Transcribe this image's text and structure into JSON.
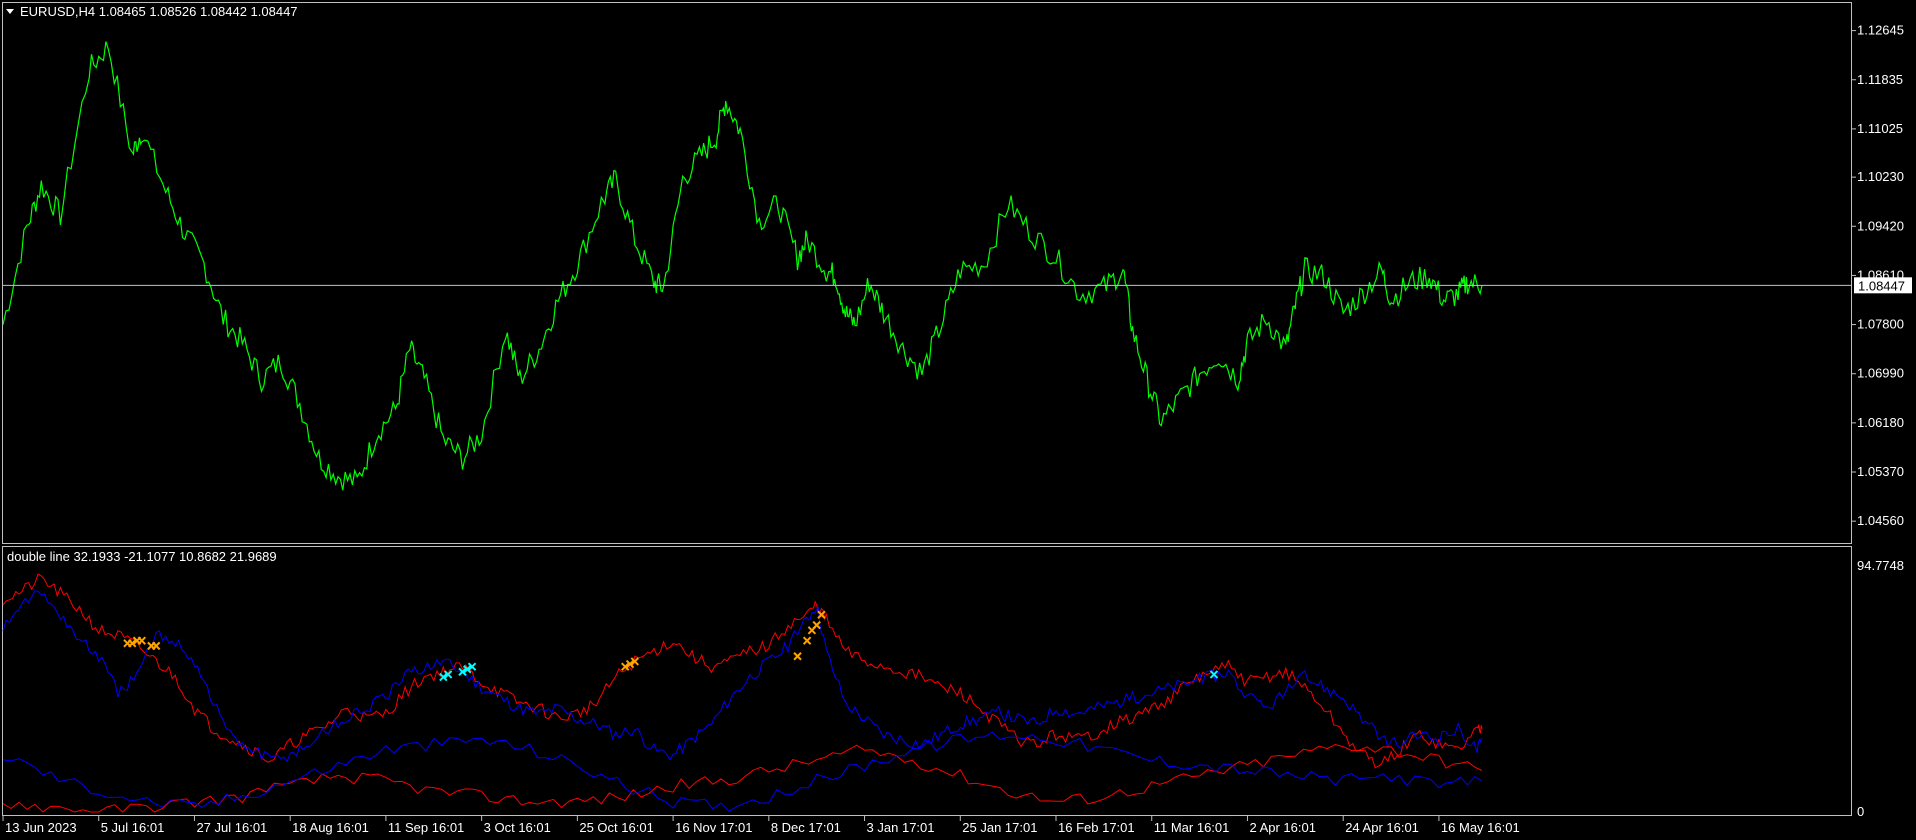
{
  "window": {
    "symbol_header": "EURUSD,H4  1.08465 1.08526 1.08442 1.08447",
    "indicator_header": "double line 32.1933 -21.1077 10.8682 21.9689"
  },
  "colors": {
    "background": "#000000",
    "price": "#00ff00",
    "last_price_line": "#b4c8dc",
    "line_red": "#ff0000",
    "line_blue": "#0000ff",
    "marker_orange": "#ffa500",
    "marker_cyan": "#00ffff",
    "panel_border": "#c0c0c0"
  },
  "icons": {
    "dropdown": "triangle-down-icon"
  },
  "chart_data": [
    {
      "type": "line",
      "panel": "main",
      "title": "EURUSD,H4",
      "ohlc_header": {
        "open": 1.08465,
        "high": 1.08526,
        "low": 1.08442,
        "close": 1.08447
      },
      "last_price": 1.08447,
      "last_price_label": "1.08447",
      "ylim": [
        1.042,
        1.131
      ],
      "y_ticks": [
        "1.12645",
        "1.11835",
        "1.11025",
        "1.10230",
        "1.09420",
        "1.08610",
        "1.07800",
        "1.06990",
        "1.06180",
        "1.05370",
        "1.04560"
      ],
      "y_tick_values": [
        1.12645,
        1.11835,
        1.11025,
        1.1023,
        1.0942,
        1.0861,
        1.078,
        1.0699,
        1.0618,
        1.0537,
        1.0456
      ],
      "x_ticks": [
        "13 Jun 2023",
        "5 Jul 16:01",
        "27 Jul 16:01",
        "18 Aug 16:01",
        "11 Sep 16:01",
        "3 Oct 16:01",
        "25 Oct 16:01",
        "16 Nov 17:01",
        "8 Dec 17:01",
        "3 Jan 17:01",
        "25 Jan 17:01",
        "16 Feb 17:01",
        "11 Mar 16:01",
        "2 Apr 16:01",
        "24 Apr 16:01",
        "16 May 16:01"
      ],
      "x_tick_bar_index": [
        0,
        20,
        40,
        60,
        80,
        100,
        120,
        140,
        160,
        180,
        200,
        220,
        240,
        260,
        280,
        300
      ],
      "bar_count": 310,
      "series": [
        {
          "color": "#00ff00",
          "x": [
            0,
            5,
            8,
            12,
            18,
            22,
            27,
            29,
            34,
            38,
            42,
            46,
            50,
            54,
            58,
            62,
            66,
            70,
            74,
            78,
            82,
            85,
            88,
            92,
            96,
            100,
            105,
            108,
            112,
            116,
            120,
            125,
            128,
            132,
            136,
            138,
            142,
            146,
            149,
            151,
            154,
            158,
            162,
            166,
            168,
            172,
            174,
            176,
            178,
            181,
            184,
            188,
            192,
            196,
            200,
            205,
            210,
            215,
            220,
            225,
            230,
            234,
            236,
            239,
            242,
            246,
            250,
            254,
            258,
            260,
            264,
            268,
            270,
            272,
            276,
            280,
            284,
            288,
            290,
            294,
            298,
            301,
            304,
            306,
            309
          ],
          "y": [
            1.078,
            1.094,
            1.101,
            1.096,
            1.12,
            1.124,
            1.106,
            1.11,
            1.1,
            1.093,
            1.088,
            1.079,
            1.075,
            1.069,
            1.072,
            1.065,
            1.056,
            1.053,
            1.052,
            1.06,
            1.064,
            1.074,
            1.069,
            1.059,
            1.056,
            1.06,
            1.077,
            1.069,
            1.074,
            1.082,
            1.088,
            1.098,
            1.102,
            1.092,
            1.085,
            1.084,
            1.102,
            1.106,
            1.109,
            1.115,
            1.11,
            1.095,
            1.098,
            1.089,
            1.092,
            1.087,
            1.086,
            1.08,
            1.078,
            1.085,
            1.08,
            1.074,
            1.07,
            1.078,
            1.087,
            1.088,
            1.098,
            1.093,
            1.089,
            1.083,
            1.084,
            1.087,
            1.077,
            1.069,
            1.062,
            1.066,
            1.07,
            1.073,
            1.069,
            1.075,
            1.079,
            1.074,
            1.081,
            1.087,
            1.086,
            1.08,
            1.083,
            1.087,
            1.082,
            1.085,
            1.086,
            1.082,
            1.083,
            1.085,
            1.0845
          ]
        }
      ]
    },
    {
      "type": "line",
      "panel": "indicator",
      "title": "double line",
      "header_values": [
        32.1933,
        -21.1077,
        10.8682,
        21.9689
      ],
      "ylim": [
        0,
        94.7748
      ],
      "y_ticks": [
        "94.7748",
        "0"
      ],
      "y_tick_values": [
        94.7748,
        0
      ],
      "series": [
        {
          "color": "#ff0000",
          "x": [
            0,
            4,
            8,
            12,
            16,
            20,
            24,
            28,
            32,
            36,
            40,
            44,
            48,
            52,
            56,
            60,
            64,
            68,
            72,
            76,
            80,
            84,
            88,
            92,
            96,
            100,
            104,
            108,
            112,
            116,
            120,
            124,
            128,
            132,
            136,
            140,
            144,
            148,
            152,
            156,
            160,
            164,
            168,
            170,
            172,
            176,
            180,
            184,
            188,
            192,
            196,
            200,
            204,
            208,
            212,
            216,
            220,
            224,
            228,
            232,
            236,
            240,
            244,
            248,
            252,
            256,
            260,
            264,
            268,
            272,
            276,
            280,
            284,
            288,
            292,
            296,
            300,
            304,
            308,
            309
          ],
          "y": [
            82,
            85,
            90,
            84,
            78,
            70,
            68,
            64,
            58,
            52,
            40,
            32,
            28,
            24,
            20,
            26,
            30,
            34,
            40,
            36,
            38,
            46,
            52,
            54,
            56,
            50,
            46,
            42,
            40,
            36,
            38,
            42,
            52,
            58,
            62,
            66,
            60,
            56,
            58,
            62,
            64,
            72,
            76,
            80,
            74,
            62,
            58,
            56,
            54,
            52,
            48,
            46,
            40,
            34,
            28,
            26,
            30,
            28,
            30,
            34,
            36,
            40,
            44,
            50,
            54,
            56,
            50,
            52,
            54,
            48,
            40,
            30,
            22,
            18,
            24,
            30,
            26,
            24,
            32,
            32
          ]
        },
        {
          "color": "#0000ff",
          "x": [
            0,
            4,
            8,
            12,
            16,
            20,
            24,
            28,
            32,
            36,
            40,
            44,
            48,
            52,
            56,
            60,
            64,
            68,
            72,
            76,
            80,
            84,
            88,
            92,
            96,
            100,
            104,
            108,
            112,
            116,
            120,
            124,
            128,
            132,
            136,
            140,
            144,
            148,
            152,
            156,
            160,
            164,
            168,
            170,
            172,
            176,
            180,
            184,
            188,
            192,
            196,
            200,
            204,
            208,
            212,
            216,
            220,
            224,
            228,
            232,
            236,
            240,
            244,
            248,
            252,
            256,
            260,
            264,
            268,
            272,
            276,
            280,
            284,
            288,
            292,
            296,
            300,
            304,
            308,
            309
          ],
          "y": [
            72,
            82,
            84,
            76,
            66,
            60,
            46,
            52,
            68,
            66,
            58,
            42,
            28,
            24,
            20,
            22,
            26,
            32,
            36,
            40,
            44,
            52,
            56,
            58,
            54,
            48,
            44,
            40,
            38,
            40,
            36,
            34,
            30,
            32,
            24,
            22,
            28,
            34,
            44,
            52,
            58,
            64,
            74,
            80,
            62,
            42,
            36,
            30,
            28,
            26,
            30,
            34,
            36,
            38,
            36,
            34,
            40,
            38,
            40,
            42,
            44,
            46,
            48,
            50,
            52,
            54,
            44,
            40,
            46,
            52,
            48,
            44,
            36,
            28,
            26,
            30,
            28,
            32,
            24,
            28
          ]
        },
        {
          "color": "#ff0000",
          "x": [
            0,
            10,
            20,
            30,
            40,
            50,
            60,
            70,
            80,
            90,
            100,
            110,
            120,
            130,
            140,
            150,
            160,
            170,
            180,
            190,
            200,
            210,
            220,
            230,
            240,
            250,
            260,
            270,
            280,
            290,
            300,
            309
          ],
          "y": [
            4,
            2,
            0,
            2,
            4,
            6,
            10,
            14,
            12,
            8,
            6,
            4,
            4,
            6,
            10,
            12,
            16,
            20,
            24,
            20,
            14,
            8,
            4,
            6,
            10,
            14,
            18,
            22,
            26,
            24,
            20,
            16
          ]
        },
        {
          "color": "#0000ff",
          "x": [
            0,
            10,
            20,
            30,
            40,
            50,
            60,
            70,
            80,
            90,
            100,
            110,
            120,
            130,
            140,
            150,
            160,
            170,
            180,
            190,
            200,
            210,
            220,
            230,
            240,
            250,
            260,
            270,
            280,
            290,
            300,
            309
          ],
          "y": [
            22,
            14,
            8,
            4,
            2,
            6,
            12,
            18,
            24,
            26,
            28,
            24,
            18,
            10,
            4,
            2,
            6,
            12,
            18,
            24,
            28,
            30,
            28,
            24,
            20,
            18,
            16,
            14,
            12,
            14,
            10,
            12
          ]
        }
      ],
      "markers": [
        {
          "color": "#ffa500",
          "x": [
            26,
            27,
            28,
            29,
            31,
            32,
            130,
            131,
            132,
            166,
            168,
            169,
            170,
            171
          ],
          "y": [
            65,
            65,
            66,
            66,
            64,
            64,
            56,
            57,
            58,
            60,
            66,
            70,
            72,
            76
          ]
        },
        {
          "color": "#00ffff",
          "x": [
            92,
            93,
            96,
            97,
            98,
            253
          ],
          "y": [
            52,
            53,
            54,
            55,
            56,
            53
          ]
        }
      ]
    }
  ]
}
